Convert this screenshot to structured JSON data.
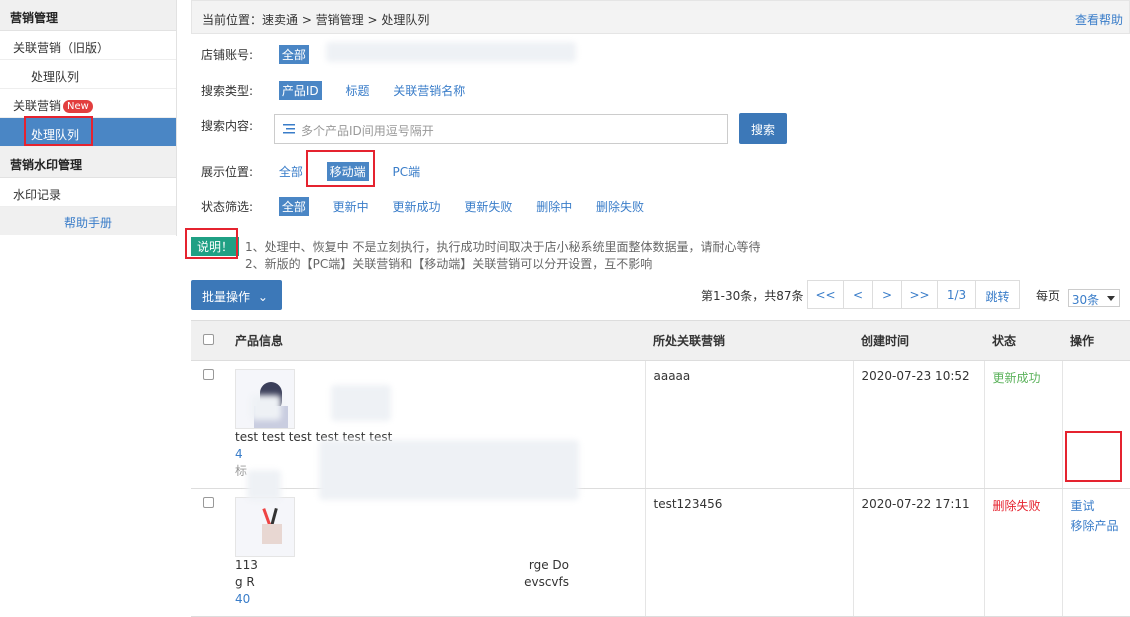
{
  "sidebar": {
    "section1_title": "营销管理",
    "item_legacy": "关联营销（旧版）",
    "item_legacy_queue": "处理队列",
    "item_new": "关联营销",
    "item_new_badge": "New",
    "item_new_queue": "处理队列",
    "section2_title": "营销水印管理",
    "item_watermark": "水印记录",
    "help": "帮助手册"
  },
  "breadcrumb": {
    "text": "当前位置：速卖通 > 营销管理 > 处理队列",
    "help": "查看帮助"
  },
  "filters": {
    "store_label": "店铺账号:",
    "store_all": "全部",
    "search_type_label": "搜索类型:",
    "search_types": [
      "产品ID",
      "标题",
      "关联营销名称"
    ],
    "search_content_label": "搜索内容:",
    "search_placeholder": "多个产品ID间用逗号隔开",
    "search_button": "搜索",
    "display_label": "展示位置:",
    "display_options": [
      "全部",
      "移动端",
      "PC端"
    ],
    "status_label": "状态筛选:",
    "status_options": [
      "全部",
      "更新中",
      "更新成功",
      "更新失败",
      "删除中",
      "删除失败"
    ]
  },
  "notes": {
    "tag": "说明！",
    "line1": "1、处理中、恢复中 不是立刻执行，执行成功时间取决于店小秘系统里面整体数据量，请耐心等待",
    "line2": "2、新版的【PC端】关联营销和【移动端】关联营销可以分开设置，互不影响"
  },
  "toolbar": {
    "batch": "批量操作",
    "summary": "第1-30条，共87条",
    "pager": [
      "<<",
      "<",
      ">",
      ">>",
      "1/3",
      "跳转"
    ],
    "per_page_label": "每页",
    "per_page_value": "30条"
  },
  "table": {
    "headers": [
      "产品信息",
      "所处关联营销",
      "创建时间",
      "状态",
      "操作"
    ],
    "rows": [
      {
        "title": "test test test test test test",
        "id_partial": "4",
        "extra_partial": "标",
        "campaign": "aaaaa",
        "created": "2020-07-23 10:52",
        "status": "更新成功",
        "actions": []
      },
      {
        "title_start": "113",
        "title_end": "rge Do",
        "line2_start": "g R",
        "line2_end": "evscvfs",
        "id_partial": "40",
        "campaign": "test123456",
        "created": "2020-07-22 17:11",
        "status": "删除失败",
        "actions": [
          "重试",
          "移除产品"
        ]
      }
    ]
  },
  "colors": {
    "primary": "#3c78b8",
    "link": "#3a7dc9",
    "highlight": "#e5232f",
    "success": "#5bb25b",
    "note_tag": "#1fa084"
  }
}
